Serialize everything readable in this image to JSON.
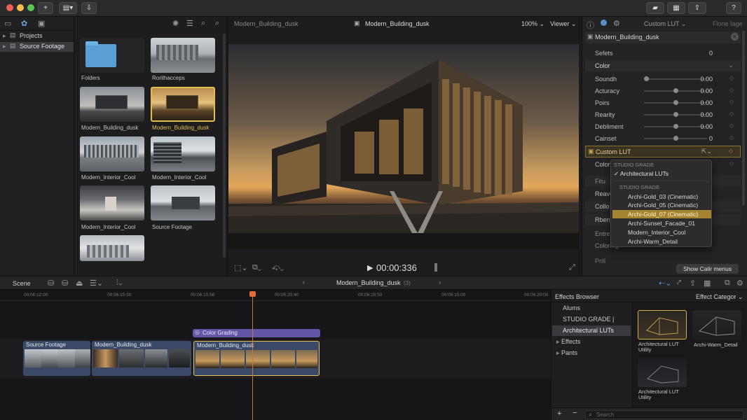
{
  "toolbar": {
    "add_icon": "plus-icon",
    "share_label": "Show Calir menus"
  },
  "sidebar": {
    "items": [
      {
        "label": "Projects"
      },
      {
        "label": "Source Footage"
      }
    ]
  },
  "browser": {
    "items": [
      {
        "label": "Folders"
      },
      {
        "label": "Rorithacceps"
      },
      {
        "label": "Modern_Building_dusk"
      },
      {
        "label": "Modern_Building_dusk"
      },
      {
        "label": "Modern_Interior_Cool"
      },
      {
        "label": "Modern_Interior_Cool"
      },
      {
        "label": "Modern_Interior_Cool"
      },
      {
        "label": "Source Footage"
      }
    ]
  },
  "viewer": {
    "title_left": "Modern_Building_dusk",
    "title_center": "Modern_Building_dusk",
    "zoom": "100%",
    "mode": "Viewer",
    "timecode": "00:00:336"
  },
  "inspector": {
    "header_right": "Custom LUT",
    "header_far": "Flone Iage",
    "clip_name": "Modern_Building_dusk",
    "effects_label": "Sefets",
    "effects_value": "0",
    "color_section": "Color",
    "rows": [
      {
        "label": "Soundh",
        "value": "0.00",
        "knob": 0.0
      },
      {
        "label": "Acturacy",
        "value": "0.00",
        "knob": 0.5
      },
      {
        "label": "Poirs",
        "value": "0.00",
        "knob": 0.5
      },
      {
        "label": "Rearity",
        "value": "0.00",
        "knob": 0.5
      },
      {
        "label": "Debliment",
        "value": "0.00",
        "knob": 0.5
      },
      {
        "label": "Cainset",
        "value": "0",
        "knob": 0.5
      }
    ],
    "custom_lut": "Custom LUT",
    "lower_rows": [
      "Color",
      "Fitu",
      "Reave",
      "Collo",
      "Rben",
      "Entre",
      "Coloring",
      "Prill"
    ],
    "bottom_button": "Show Calir menus"
  },
  "dropdown": {
    "group1": "STUDIO GRADE",
    "checked": "Architectural LUTs",
    "group2": "STUDIO GRADE",
    "items": [
      {
        "label": "Archi-Gold_03 (Cinematic)"
      },
      {
        "label": "Archi-Gold_05 (Cinematic)"
      },
      {
        "label": "Archi-Gold_07 (Cinematic)",
        "selected": true
      },
      {
        "label": "Archi-Sunset_Facade_01"
      },
      {
        "label": "Modern_Interior_Cool"
      },
      {
        "label": "Archi-Warm_Detail"
      }
    ]
  },
  "timeline": {
    "scene_label": "Scene",
    "project_name": "Modern_Building_dusk",
    "project_count": "(3)",
    "ruler": [
      "00:06:12:00",
      "00:06:15:30",
      "00:06:15:56",
      "00:05:20:40",
      "00:06:15:50",
      "00:06:15:00",
      "00:06:20:00"
    ],
    "color_grading": "Color Grading",
    "clips": [
      {
        "label": "Source Footage"
      },
      {
        "label": "Modern_Building_dusk"
      },
      {
        "label": "Modern_Building_dusk"
      }
    ]
  },
  "effects": {
    "title": "Effects Browser",
    "category": "Effect Categor",
    "list": [
      "Alums",
      "STUDIO GRADE |",
      "Architectural LUTs",
      "Effects",
      "Pants"
    ],
    "tiles": [
      {
        "label": "Architectural LUT Utility"
      },
      {
        "label": "Archi-Warm_Detail"
      },
      {
        "label": "Architectural LUT Utility"
      }
    ],
    "search_placeholder": "Search"
  }
}
